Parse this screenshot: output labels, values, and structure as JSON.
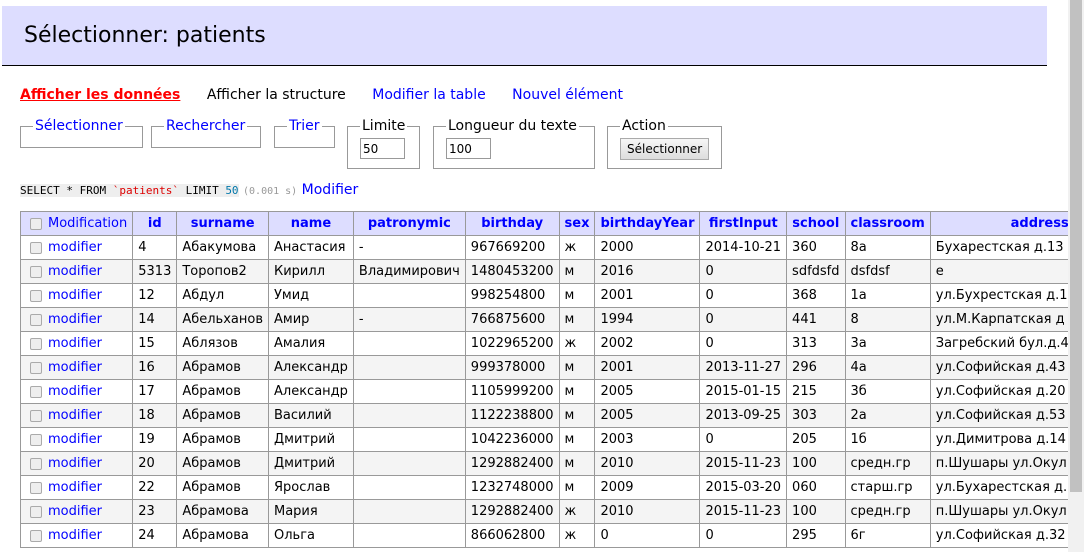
{
  "title": "Sélectionner: patients",
  "nav": {
    "show_data": "Afficher les données",
    "show_structure": "Afficher la structure",
    "alter_table": "Modifier la table",
    "new_item": "Nouvel élément"
  },
  "filters": {
    "select": "Sélectionner",
    "search": "Rechercher",
    "sort": "Trier",
    "limit_label": "Limite",
    "limit_value": "50",
    "text_length_label": "Longueur du texte",
    "text_length_value": "100",
    "action_label": "Action",
    "action_button": "Sélectionner"
  },
  "query": {
    "kw1": "SELECT * FROM ",
    "table": "`patients`",
    "kw2": " LIMIT ",
    "limit": "50",
    "time": "(0.001 s)",
    "edit": "Modifier"
  },
  "table": {
    "columns": [
      "Modification",
      "id",
      "surname",
      "name",
      "patronymic",
      "birthday",
      "sex",
      "birthdayYear",
      "firstInput",
      "school",
      "classroom",
      "address"
    ],
    "edit_label": "modifier",
    "rows": [
      [
        "4",
        "Абакумова",
        "Анастасия",
        "-",
        "967669200",
        "ж",
        "2000",
        "2014-10-21",
        "360",
        "8а",
        "Бухарестская д.13"
      ],
      [
        "5313",
        "Торопов2",
        "Кирилл",
        "Владимирович",
        "1480453200",
        "м",
        "2016",
        "0",
        "sdfdsfd",
        "dsfdsf",
        "е"
      ],
      [
        "12",
        "Абдул",
        "Умид",
        "",
        "998254800",
        "м",
        "2001",
        "0",
        "368",
        "1а",
        "ул.Бухрестская д.1"
      ],
      [
        "14",
        "Абельханов",
        "Амир",
        "-",
        "766875600",
        "м",
        "1994",
        "0",
        "441",
        "8",
        "ул.М.Карпатская д"
      ],
      [
        "15",
        "Аблязов",
        "Амалия",
        "",
        "1022965200",
        "ж",
        "2002",
        "0",
        "313",
        "3а",
        "Загребский бул.д.4"
      ],
      [
        "16",
        "Абрамов",
        "Александр",
        "",
        "999378000",
        "м",
        "2001",
        "2013-11-27",
        "296",
        "4а",
        "ул.Софийская д.43"
      ],
      [
        "17",
        "Абрамов",
        "Александр",
        "",
        "1105999200",
        "м",
        "2005",
        "2015-01-15",
        "215",
        "3б",
        "ул.Софийская д.20"
      ],
      [
        "18",
        "Абрамов",
        "Василий",
        "",
        "1122238800",
        "м",
        "2005",
        "2013-09-25",
        "303",
        "2а",
        "ул.Софийская д.53"
      ],
      [
        "19",
        "Абрамов",
        "Дмитрий",
        "",
        "1042236000",
        "м",
        "2003",
        "0",
        "205",
        "1б",
        "ул.Димитрова д.14"
      ],
      [
        "20",
        "Абрамов",
        "Дмитрий",
        "",
        "1292882400",
        "м",
        "2010",
        "2015-11-23",
        "100",
        "средн.гр",
        "п.Шушары ул.Окул"
      ],
      [
        "22",
        "Абрамов",
        "Ярослав",
        "",
        "1232748000",
        "м",
        "2009",
        "2015-03-20",
        "060",
        "старш.гр",
        "ул.Бухарестская д."
      ],
      [
        "23",
        "Абрамова",
        "Мария",
        "",
        "1292882400",
        "ж",
        "2010",
        "2015-11-23",
        "100",
        "средн.гр",
        "п.Шушары ул.Окул"
      ],
      [
        "24",
        "Абрамова",
        "Ольга",
        "",
        "866062800",
        "ж",
        "0",
        "0",
        "295",
        "6г",
        "ул.Софийская д.32"
      ]
    ]
  }
}
